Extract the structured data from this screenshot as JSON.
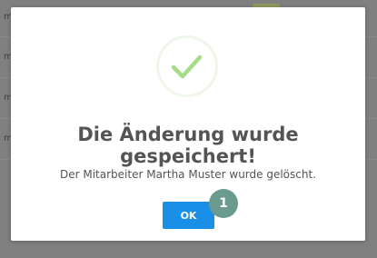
{
  "background": {
    "rows": [
      "m",
      "m",
      "m",
      "m"
    ]
  },
  "dialog": {
    "title": "Die Änderung wurde gespeichert!",
    "message": "Der Mitarbeiter Martha Muster wurde gelöscht.",
    "ok_label": "OK",
    "icon": "success-checkmark-icon",
    "step_marker": "1"
  },
  "colors": {
    "check": "#a5dc86",
    "button": "#1a8fe8",
    "step_marker": "#6a9b8e",
    "text": "#545454"
  }
}
